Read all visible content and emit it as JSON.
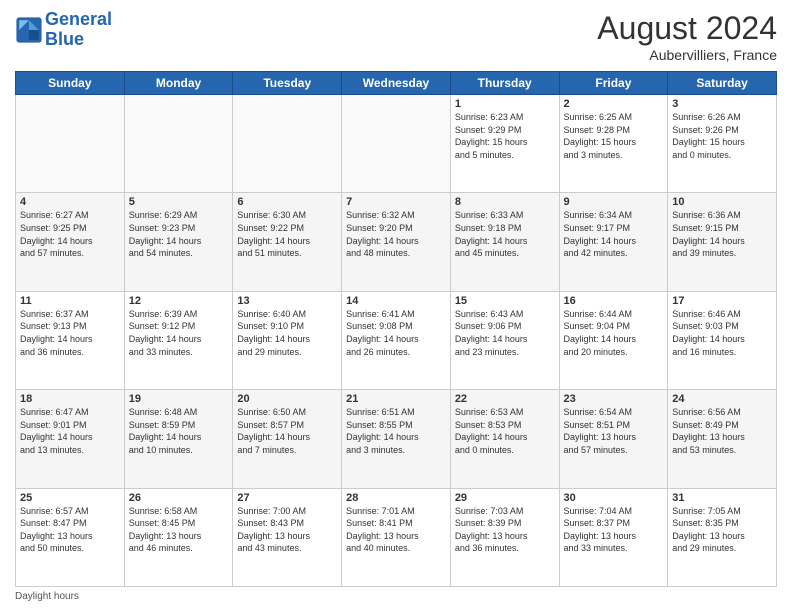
{
  "header": {
    "logo_line1": "General",
    "logo_line2": "Blue",
    "month": "August 2024",
    "location": "Aubervilliers, France"
  },
  "days_of_week": [
    "Sunday",
    "Monday",
    "Tuesday",
    "Wednesday",
    "Thursday",
    "Friday",
    "Saturday"
  ],
  "weeks": [
    [
      {
        "day": "",
        "info": ""
      },
      {
        "day": "",
        "info": ""
      },
      {
        "day": "",
        "info": ""
      },
      {
        "day": "",
        "info": ""
      },
      {
        "day": "1",
        "info": "Sunrise: 6:23 AM\nSunset: 9:29 PM\nDaylight: 15 hours\nand 5 minutes."
      },
      {
        "day": "2",
        "info": "Sunrise: 6:25 AM\nSunset: 9:28 PM\nDaylight: 15 hours\nand 3 minutes."
      },
      {
        "day": "3",
        "info": "Sunrise: 6:26 AM\nSunset: 9:26 PM\nDaylight: 15 hours\nand 0 minutes."
      }
    ],
    [
      {
        "day": "4",
        "info": "Sunrise: 6:27 AM\nSunset: 9:25 PM\nDaylight: 14 hours\nand 57 minutes."
      },
      {
        "day": "5",
        "info": "Sunrise: 6:29 AM\nSunset: 9:23 PM\nDaylight: 14 hours\nand 54 minutes."
      },
      {
        "day": "6",
        "info": "Sunrise: 6:30 AM\nSunset: 9:22 PM\nDaylight: 14 hours\nand 51 minutes."
      },
      {
        "day": "7",
        "info": "Sunrise: 6:32 AM\nSunset: 9:20 PM\nDaylight: 14 hours\nand 48 minutes."
      },
      {
        "day": "8",
        "info": "Sunrise: 6:33 AM\nSunset: 9:18 PM\nDaylight: 14 hours\nand 45 minutes."
      },
      {
        "day": "9",
        "info": "Sunrise: 6:34 AM\nSunset: 9:17 PM\nDaylight: 14 hours\nand 42 minutes."
      },
      {
        "day": "10",
        "info": "Sunrise: 6:36 AM\nSunset: 9:15 PM\nDaylight: 14 hours\nand 39 minutes."
      }
    ],
    [
      {
        "day": "11",
        "info": "Sunrise: 6:37 AM\nSunset: 9:13 PM\nDaylight: 14 hours\nand 36 minutes."
      },
      {
        "day": "12",
        "info": "Sunrise: 6:39 AM\nSunset: 9:12 PM\nDaylight: 14 hours\nand 33 minutes."
      },
      {
        "day": "13",
        "info": "Sunrise: 6:40 AM\nSunset: 9:10 PM\nDaylight: 14 hours\nand 29 minutes."
      },
      {
        "day": "14",
        "info": "Sunrise: 6:41 AM\nSunset: 9:08 PM\nDaylight: 14 hours\nand 26 minutes."
      },
      {
        "day": "15",
        "info": "Sunrise: 6:43 AM\nSunset: 9:06 PM\nDaylight: 14 hours\nand 23 minutes."
      },
      {
        "day": "16",
        "info": "Sunrise: 6:44 AM\nSunset: 9:04 PM\nDaylight: 14 hours\nand 20 minutes."
      },
      {
        "day": "17",
        "info": "Sunrise: 6:46 AM\nSunset: 9:03 PM\nDaylight: 14 hours\nand 16 minutes."
      }
    ],
    [
      {
        "day": "18",
        "info": "Sunrise: 6:47 AM\nSunset: 9:01 PM\nDaylight: 14 hours\nand 13 minutes."
      },
      {
        "day": "19",
        "info": "Sunrise: 6:48 AM\nSunset: 8:59 PM\nDaylight: 14 hours\nand 10 minutes."
      },
      {
        "day": "20",
        "info": "Sunrise: 6:50 AM\nSunset: 8:57 PM\nDaylight: 14 hours\nand 7 minutes."
      },
      {
        "day": "21",
        "info": "Sunrise: 6:51 AM\nSunset: 8:55 PM\nDaylight: 14 hours\nand 3 minutes."
      },
      {
        "day": "22",
        "info": "Sunrise: 6:53 AM\nSunset: 8:53 PM\nDaylight: 14 hours\nand 0 minutes."
      },
      {
        "day": "23",
        "info": "Sunrise: 6:54 AM\nSunset: 8:51 PM\nDaylight: 13 hours\nand 57 minutes."
      },
      {
        "day": "24",
        "info": "Sunrise: 6:56 AM\nSunset: 8:49 PM\nDaylight: 13 hours\nand 53 minutes."
      }
    ],
    [
      {
        "day": "25",
        "info": "Sunrise: 6:57 AM\nSunset: 8:47 PM\nDaylight: 13 hours\nand 50 minutes."
      },
      {
        "day": "26",
        "info": "Sunrise: 6:58 AM\nSunset: 8:45 PM\nDaylight: 13 hours\nand 46 minutes."
      },
      {
        "day": "27",
        "info": "Sunrise: 7:00 AM\nSunset: 8:43 PM\nDaylight: 13 hours\nand 43 minutes."
      },
      {
        "day": "28",
        "info": "Sunrise: 7:01 AM\nSunset: 8:41 PM\nDaylight: 13 hours\nand 40 minutes."
      },
      {
        "day": "29",
        "info": "Sunrise: 7:03 AM\nSunset: 8:39 PM\nDaylight: 13 hours\nand 36 minutes."
      },
      {
        "day": "30",
        "info": "Sunrise: 7:04 AM\nSunset: 8:37 PM\nDaylight: 13 hours\nand 33 minutes."
      },
      {
        "day": "31",
        "info": "Sunrise: 7:05 AM\nSunset: 8:35 PM\nDaylight: 13 hours\nand 29 minutes."
      }
    ]
  ],
  "footer": {
    "note": "Daylight hours"
  }
}
